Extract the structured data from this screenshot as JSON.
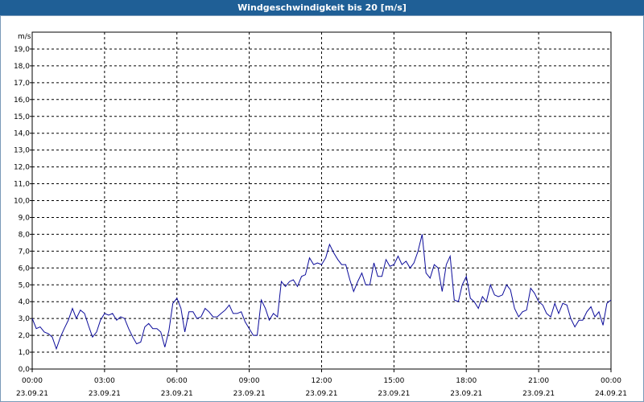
{
  "colors": {
    "title_bar": "#1f5f96",
    "line": "#0b0b9a",
    "grid": "#000000"
  },
  "chart_data": {
    "type": "line",
    "title": "Windgeschwindigkeit bis 20 [m/s]",
    "ylabel": "m/s",
    "xlabel": "",
    "ylim": [
      0,
      20
    ],
    "xlim_hours": [
      0,
      24
    ],
    "grid": true,
    "y_ticks": [
      "0,0",
      "1,0",
      "2,0",
      "3,0",
      "4,0",
      "5,0",
      "6,0",
      "7,0",
      "8,0",
      "9,0",
      "10,0",
      "11,0",
      "12,0",
      "13,0",
      "14,0",
      "15,0",
      "16,0",
      "17,0",
      "18,0",
      "19,0"
    ],
    "x_ticks": [
      {
        "time": "00:00",
        "date": "23.09.21"
      },
      {
        "time": "03:00",
        "date": "23.09.21"
      },
      {
        "time": "06:00",
        "date": "23.09.21"
      },
      {
        "time": "09:00",
        "date": "23.09.21"
      },
      {
        "time": "12:00",
        "date": "23.09.21"
      },
      {
        "time": "15:00",
        "date": "23.09.21"
      },
      {
        "time": "18:00",
        "date": "23.09.21"
      },
      {
        "time": "21:00",
        "date": "23.09.21"
      },
      {
        "time": "00:00",
        "date": "24.09.21"
      }
    ],
    "series": [
      {
        "x": [
          0,
          0.17,
          0.33,
          0.5,
          0.67,
          0.83,
          1.0,
          1.17,
          1.33,
          1.5,
          1.67,
          1.83,
          2.0,
          2.17,
          2.33,
          2.5,
          2.67,
          2.83,
          3.0,
          3.17,
          3.33,
          3.5,
          3.67,
          3.83,
          4.0,
          4.17,
          4.33,
          4.5,
          4.67,
          4.83,
          5.0,
          5.17,
          5.33,
          5.5,
          5.67,
          5.83,
          6.0,
          6.17,
          6.33,
          6.5,
          6.67,
          6.83,
          7.0,
          7.17,
          7.33,
          7.5,
          7.67,
          7.83,
          8.0,
          8.17,
          8.33,
          8.5,
          8.67,
          8.83,
          9.0,
          9.17,
          9.33,
          9.5,
          9.67,
          9.83,
          10.0,
          10.17,
          10.33,
          10.5,
          10.67,
          10.83,
          11.0,
          11.17,
          11.33,
          11.5,
          11.67,
          11.83,
          12.0,
          12.17,
          12.33,
          12.5,
          12.67,
          12.83,
          13.0,
          13.17,
          13.33,
          13.5,
          13.67,
          13.83,
          14.0,
          14.17,
          14.33,
          14.5,
          14.67,
          14.83,
          15.0,
          15.17,
          15.33,
          15.5,
          15.67,
          15.83,
          16.0,
          16.17,
          16.33,
          16.5,
          16.67,
          16.83,
          17.0,
          17.17,
          17.33,
          17.5,
          17.67,
          17.83,
          18.0,
          18.17,
          18.33,
          18.5,
          18.67,
          18.83,
          19.0,
          19.17,
          19.33,
          19.5,
          19.67,
          19.83,
          20.0,
          20.17,
          20.33,
          20.5,
          20.67,
          20.83,
          21.0,
          21.17,
          21.33,
          21.5,
          21.67,
          21.83,
          22.0,
          22.17,
          22.33,
          22.5,
          22.67,
          22.83,
          23.0,
          23.17,
          23.33,
          23.5,
          23.67,
          23.83,
          24.0
        ],
        "values": [
          3.0,
          2.4,
          2.5,
          2.2,
          2.1,
          1.9,
          1.2,
          1.9,
          2.4,
          2.9,
          3.6,
          3.0,
          3.5,
          3.3,
          2.6,
          1.9,
          2.2,
          2.9,
          3.3,
          3.2,
          3.3,
          2.9,
          3.1,
          3.0,
          2.4,
          1.9,
          1.5,
          1.6,
          2.5,
          2.7,
          2.4,
          2.4,
          2.2,
          1.3,
          2.3,
          3.9,
          4.2,
          3.6,
          2.2,
          3.4,
          3.4,
          3.0,
          3.1,
          3.6,
          3.4,
          3.1,
          3.1,
          3.3,
          3.5,
          3.8,
          3.3,
          3.3,
          3.4,
          2.8,
          2.4,
          2.0,
          2.0,
          4.1,
          3.6,
          2.9,
          3.3,
          3.1,
          5.2,
          4.9,
          5.2,
          5.3,
          4.9,
          5.5,
          5.6,
          6.6,
          6.2,
          6.3,
          6.2,
          6.6,
          7.4,
          6.9,
          6.5,
          6.2,
          6.2,
          5.3,
          4.6,
          5.2,
          5.7,
          5.0,
          5.0,
          6.3,
          5.5,
          5.5,
          6.5,
          6.1,
          6.2,
          6.7,
          6.2,
          6.4,
          6.0,
          6.3,
          7.0,
          8.0,
          5.7,
          5.4,
          6.2,
          6.0,
          4.6,
          6.2,
          6.7,
          4.1,
          4.0,
          5.0,
          5.5,
          4.2,
          4.0,
          3.6,
          4.3,
          4.0,
          5.0,
          4.4,
          4.3,
          4.4,
          5.0,
          4.7,
          3.6,
          3.1,
          3.4,
          3.5,
          4.8,
          4.5,
          4.0,
          3.8,
          3.3,
          3.1,
          3.9,
          3.3,
          3.9,
          3.8,
          3.0,
          2.5,
          2.9,
          2.9,
          3.4,
          3.7,
          3.1,
          3.4,
          2.6,
          3.9,
          4.1
        ]
      }
    ]
  }
}
